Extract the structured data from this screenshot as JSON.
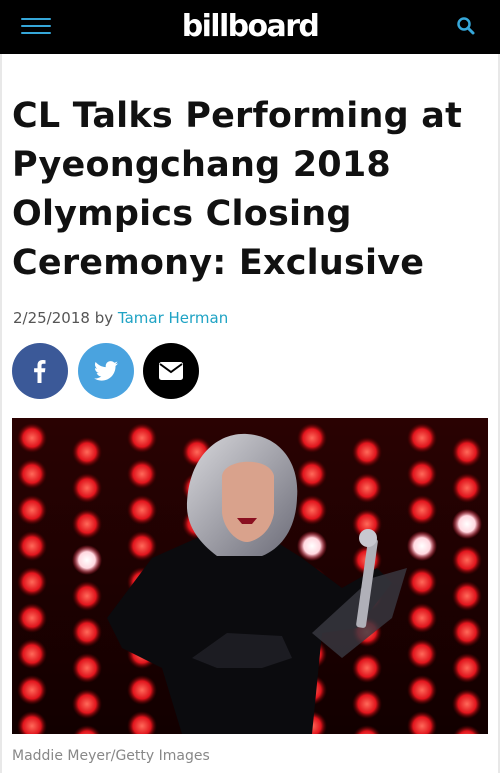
{
  "header": {
    "logo_text": "billboard",
    "menu_icon": "hamburger-menu-icon",
    "search_icon": "search-icon",
    "accent_color": "#36a7d9"
  },
  "article": {
    "headline": "CL Talks Performing at Pyeongchang 2018 Olympics Closing Ceremony: Exclusive",
    "date": "2/25/2018",
    "by": "by",
    "author": "Tamar Herman",
    "share": {
      "facebook_icon": "facebook-icon",
      "twitter_icon": "twitter-icon",
      "email_icon": "email-icon",
      "facebook_color": "#3b5998",
      "twitter_color": "#4aa3df",
      "email_color": "#000000"
    },
    "photo_caption": "Maddie Meyer/Getty Images"
  }
}
